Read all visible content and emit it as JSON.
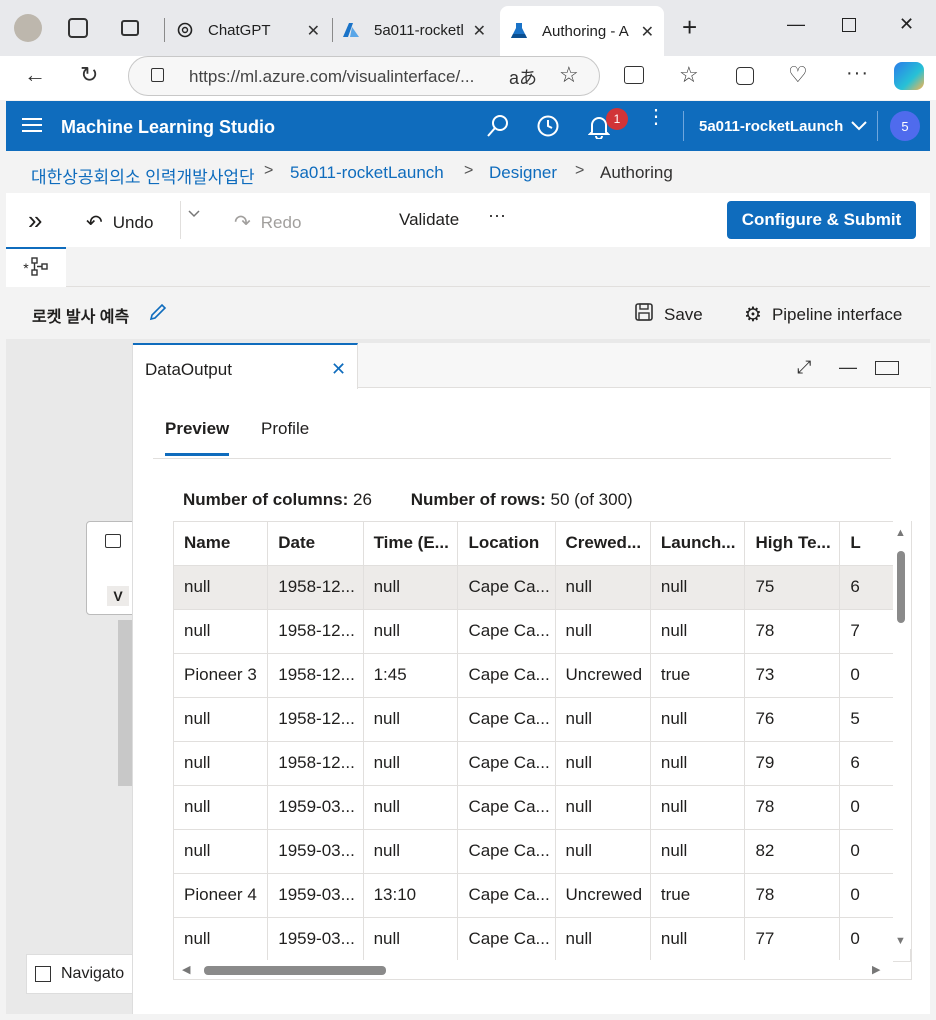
{
  "browser": {
    "tabs": [
      {
        "label": "ChatGPT",
        "icon": "chatgpt-icon"
      },
      {
        "label": "5a011-rocketl",
        "icon": "azure-icon"
      },
      {
        "label": "Authoring - A",
        "icon": "ml-flask-icon"
      }
    ],
    "url": "https://ml.azure.com/visualinterface/..."
  },
  "app": {
    "title": "Machine Learning Studio",
    "notification_count": "1",
    "workspace": "5a011-rocketLaunch",
    "avatar": "5"
  },
  "breadcrumb": [
    "대한상공회의소 인력개발사업단",
    "5a011-rocketLaunch",
    "Designer",
    "Authoring"
  ],
  "toolbar": {
    "undo": "Undo",
    "redo": "Redo",
    "validate": "Validate",
    "more": "···",
    "submit": "Configure & Submit"
  },
  "doc_tab": "*",
  "pipeline": {
    "title": "로켓 발사 예측",
    "save": "Save",
    "interface": "Pipeline interface"
  },
  "canvas": {
    "node_label": "V",
    "navigator": "Navigato"
  },
  "panel": {
    "tab_title": "DataOutput",
    "subtabs": [
      "Preview",
      "Profile"
    ],
    "columns_label": "Number of columns:",
    "columns_value": "26",
    "rows_label": "Number of rows:",
    "rows_value": "50 (of 300)"
  },
  "table": {
    "headers": [
      "Name",
      "Date",
      "Time (E...",
      "Location",
      "Crewed...",
      "Launch...",
      "High Te...",
      "L"
    ],
    "rows": [
      [
        "null",
        "1958-12...",
        "null",
        "Cape Ca...",
        "null",
        "null",
        "75",
        "6"
      ],
      [
        "null",
        "1958-12...",
        "null",
        "Cape Ca...",
        "null",
        "null",
        "78",
        "7"
      ],
      [
        "Pioneer 3",
        "1958-12...",
        "1:45",
        "Cape Ca...",
        "Uncrewed",
        "true",
        "73",
        "0"
      ],
      [
        "null",
        "1958-12...",
        "null",
        "Cape Ca...",
        "null",
        "null",
        "76",
        "5"
      ],
      [
        "null",
        "1958-12...",
        "null",
        "Cape Ca...",
        "null",
        "null",
        "79",
        "6"
      ],
      [
        "null",
        "1959-03...",
        "null",
        "Cape Ca...",
        "null",
        "null",
        "78",
        "0"
      ],
      [
        "null",
        "1959-03...",
        "null",
        "Cape Ca...",
        "null",
        "null",
        "82",
        "0"
      ],
      [
        "Pioneer 4",
        "1959-03...",
        "13:10",
        "Cape Ca...",
        "Uncrewed",
        "true",
        "78",
        "0"
      ],
      [
        "null",
        "1959-03...",
        "null",
        "Cape Ca...",
        "null",
        "null",
        "77",
        "0"
      ]
    ]
  },
  "colors": {
    "accent": "#0f6cbd",
    "badge": "#d13438",
    "avatar": "#4f6bed"
  }
}
